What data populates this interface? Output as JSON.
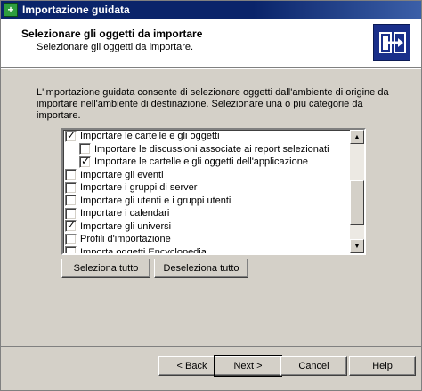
{
  "window": {
    "title": "Importazione guidata"
  },
  "header": {
    "title": "Selezionare gli oggetti da importare",
    "subtitle": "Selezionare gli oggetti da importare."
  },
  "description": "L'importazione guidata consente di selezionare oggetti dall'ambiente di origine da importare nell'ambiente di destinazione. Selezionare una o più categorie da importare.",
  "list": {
    "items": [
      {
        "label": "Importare le cartelle e gli oggetti",
        "checked": true,
        "indent": 0
      },
      {
        "label": "Importare le discussioni associate ai report selezionati",
        "checked": false,
        "indent": 1
      },
      {
        "label": "Importare le cartelle e gli oggetti dell'applicazione",
        "checked": true,
        "indent": 1
      },
      {
        "label": "Importare gli eventi",
        "checked": false,
        "indent": 0
      },
      {
        "label": "Importare i gruppi di server",
        "checked": false,
        "indent": 0
      },
      {
        "label": "Importare gli utenti e i gruppi utenti",
        "checked": false,
        "indent": 0
      },
      {
        "label": "Importare i calendari",
        "checked": false,
        "indent": 0
      },
      {
        "label": "Importare gli universi",
        "checked": true,
        "indent": 0
      },
      {
        "label": "Profili d'importazione",
        "checked": false,
        "indent": 0
      },
      {
        "label": "Importa oggetti Encyclopedia",
        "checked": false,
        "indent": 0
      }
    ]
  },
  "buttons": {
    "select_all": "Seleziona tutto",
    "deselect_all": "Deseleziona tutto",
    "back": "< Back",
    "next": "Next >",
    "cancel": "Cancel",
    "help": "Help"
  },
  "icons": {
    "app": "green-cross-icon",
    "header": "import-objects-icon"
  }
}
